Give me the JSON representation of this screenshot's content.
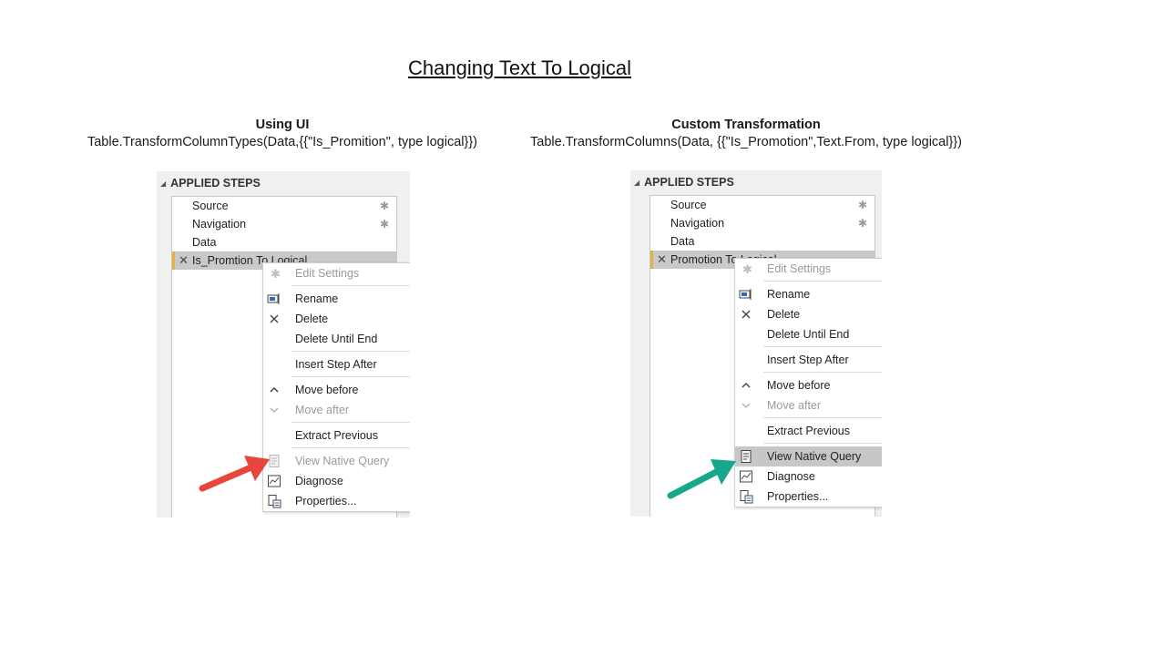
{
  "slide": {
    "title": "Changing Text To Logical"
  },
  "left": {
    "heading": "Using UI",
    "code": "Table.TransformColumnTypes(Data,{{\"Is_Promition\", type logical}})",
    "panel_title": "APPLIED STEPS",
    "steps": [
      {
        "label": "Source",
        "gear": true
      },
      {
        "label": "Navigation",
        "gear": true
      },
      {
        "label": "Data",
        "gear": false
      },
      {
        "label": "Is_Promtion To Logical",
        "gear": false,
        "selected": true
      }
    ],
    "menu": [
      {
        "label": "Edit Settings",
        "icon": "gear-icon",
        "disabled": true
      },
      {
        "label": "Rename",
        "icon": "rename-icon"
      },
      {
        "label": "Delete",
        "icon": "delete-x-icon"
      },
      {
        "label": "Delete Until End",
        "icon": ""
      },
      {
        "label": "Insert Step After",
        "icon": ""
      },
      {
        "label": "Move before",
        "icon": "chevron-up-icon"
      },
      {
        "label": "Move after",
        "icon": "chevron-down-icon",
        "disabled": true
      },
      {
        "label": "Extract Previous",
        "icon": ""
      },
      {
        "label": "View Native Query",
        "icon": "native-query-icon",
        "disabled": true
      },
      {
        "label": "Diagnose",
        "icon": "diagnose-icon"
      },
      {
        "label": "Properties...",
        "icon": "properties-icon"
      }
    ],
    "arrow_color": "#e8453c"
  },
  "right": {
    "heading": "Custom Transformation",
    "code": "Table.TransformColumns(Data, {{\"Is_Promotion\",Text.From,  type logical}})",
    "panel_title": "APPLIED STEPS",
    "steps": [
      {
        "label": "Source",
        "gear": true
      },
      {
        "label": "Navigation",
        "gear": true
      },
      {
        "label": "Data",
        "gear": false
      },
      {
        "label": "Promotion To Logical",
        "gear": false,
        "selected": true
      }
    ],
    "menu": [
      {
        "label": "Edit Settings",
        "icon": "gear-icon",
        "disabled": true
      },
      {
        "label": "Rename",
        "icon": "rename-icon"
      },
      {
        "label": "Delete",
        "icon": "delete-x-icon"
      },
      {
        "label": "Delete Until End",
        "icon": ""
      },
      {
        "label": "Insert Step After",
        "icon": ""
      },
      {
        "label": "Move before",
        "icon": "chevron-up-icon"
      },
      {
        "label": "Move after",
        "icon": "chevron-down-icon",
        "disabled": true
      },
      {
        "label": "Extract Previous",
        "icon": ""
      },
      {
        "label": "View Native Query",
        "icon": "native-query-icon",
        "highlight": true
      },
      {
        "label": "Diagnose",
        "icon": "diagnose-icon"
      },
      {
        "label": "Properties...",
        "icon": "properties-icon"
      }
    ],
    "arrow_color": "#17a88c"
  }
}
